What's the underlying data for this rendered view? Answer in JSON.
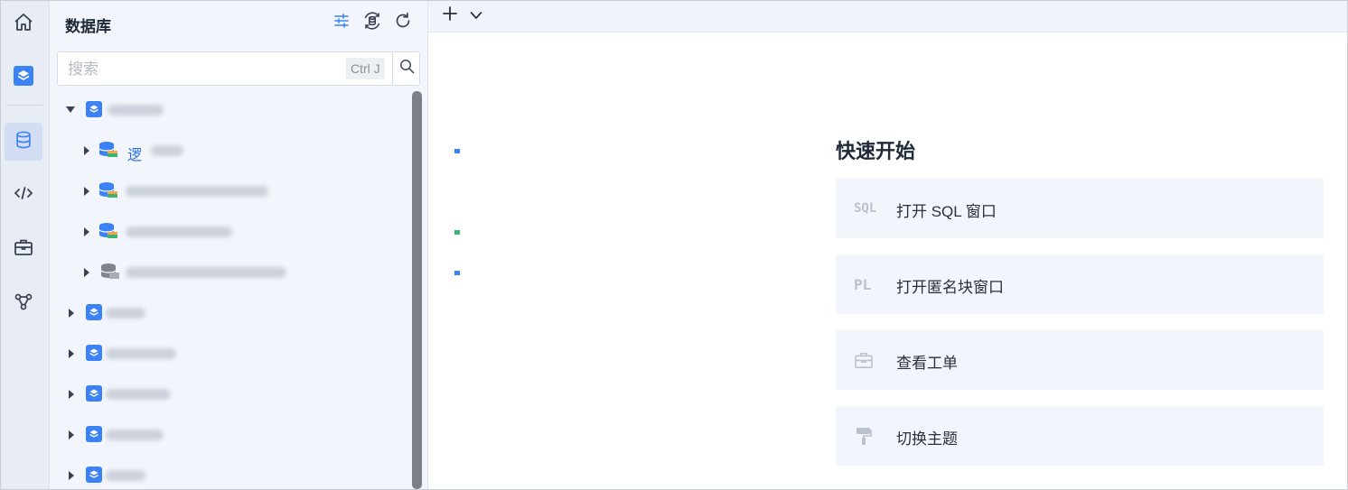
{
  "panel": {
    "title": "数据库",
    "search_placeholder": "搜索",
    "search_shortcut": "Ctrl J"
  },
  "tree": {
    "partial_label": "逻"
  },
  "quick_start": {
    "title": "快速开始",
    "items": [
      {
        "icon_text": "SQL",
        "label": "打开 SQL 窗口"
      },
      {
        "icon_text": "PL",
        "label": "打开匿名块窗口"
      },
      {
        "icon": "ticket-icon",
        "label": "查看工单"
      },
      {
        "icon": "paint-roller-icon",
        "label": "切换主题"
      }
    ]
  },
  "colors": {
    "accent": "#3b82f6",
    "status_green": "#3cb371"
  }
}
